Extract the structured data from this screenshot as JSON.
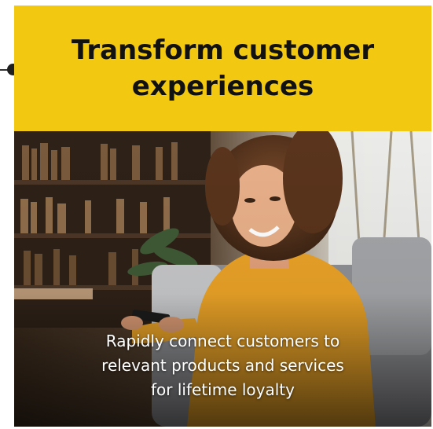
{
  "colors": {
    "accent_yellow": "#f2c811",
    "heading_text": "#111111",
    "caption_text": "#ffffff"
  },
  "card": {
    "title_line1": "Transform customer",
    "title_line2": "experiences",
    "caption_line1": "Rapidly connect customers to",
    "caption_line2": "relevant products and services",
    "caption_line3": "for lifetime loyalty"
  }
}
